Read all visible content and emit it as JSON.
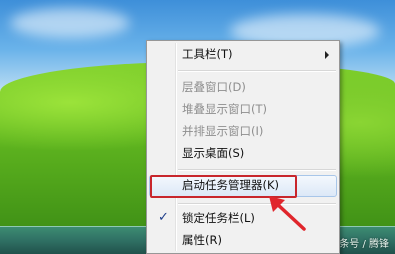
{
  "menu": {
    "items": [
      {
        "label": "工具栏(T)"
      },
      {
        "label": "层叠窗口(D)"
      },
      {
        "label": "堆叠显示窗口(T)"
      },
      {
        "label": "并排显示窗口(I)"
      },
      {
        "label": "显示桌面(S)"
      },
      {
        "label": "启动任务管理器(K)"
      },
      {
        "label": "锁定任务栏(L)"
      },
      {
        "label": "属性(R)"
      }
    ]
  },
  "watermark": "头条号 / 腾锋",
  "colors": {
    "highlight_box": "#c8262c",
    "arrow": "#e0262c"
  }
}
